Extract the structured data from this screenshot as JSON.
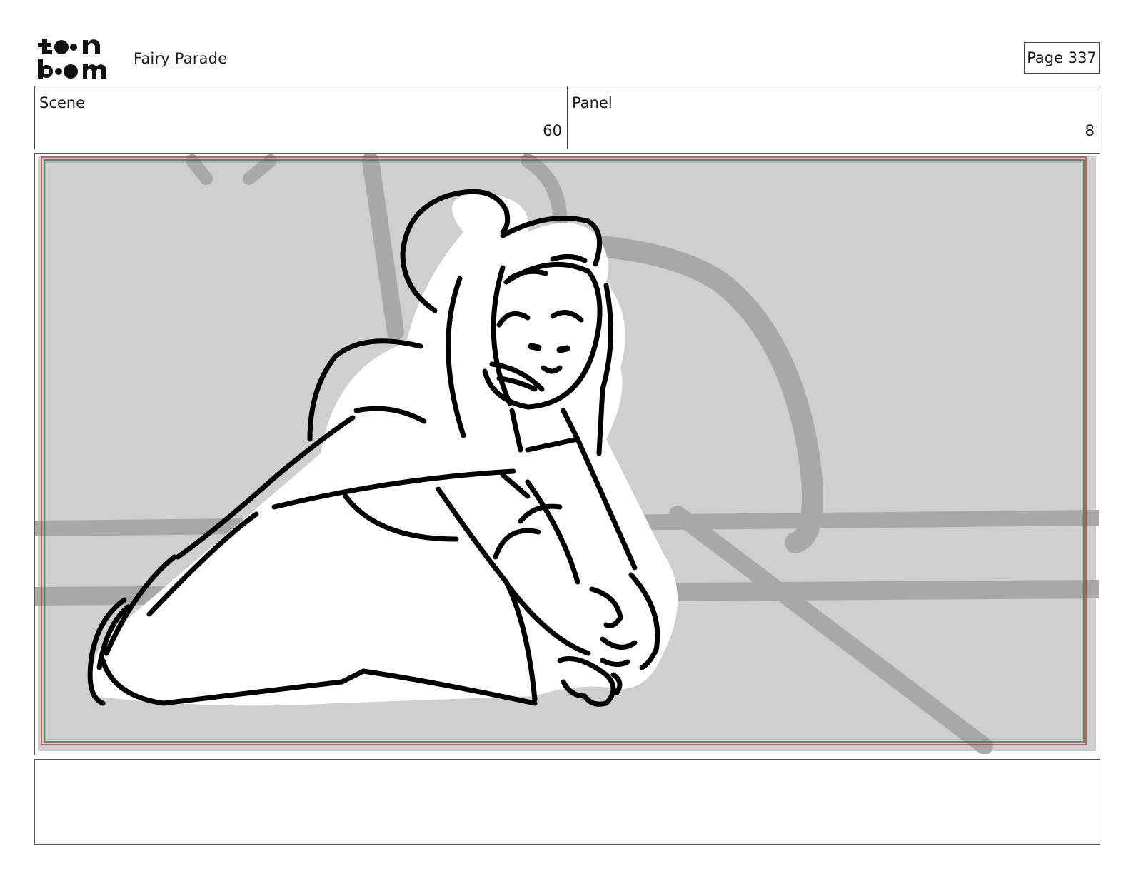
{
  "header": {
    "logo_text_top": "toon",
    "logo_text_bottom": "boom",
    "project_title": "Fairy Parade",
    "page_label": "Page 337"
  },
  "info": {
    "scene_label": "Scene",
    "scene_value": "60",
    "panel_label": "Panel",
    "panel_value": "8"
  },
  "panel_image": {
    "description_icon": "storyboard-sketch",
    "background_color": "#cfcfcf",
    "line_color": "#000000"
  },
  "notes": {
    "text": ""
  }
}
